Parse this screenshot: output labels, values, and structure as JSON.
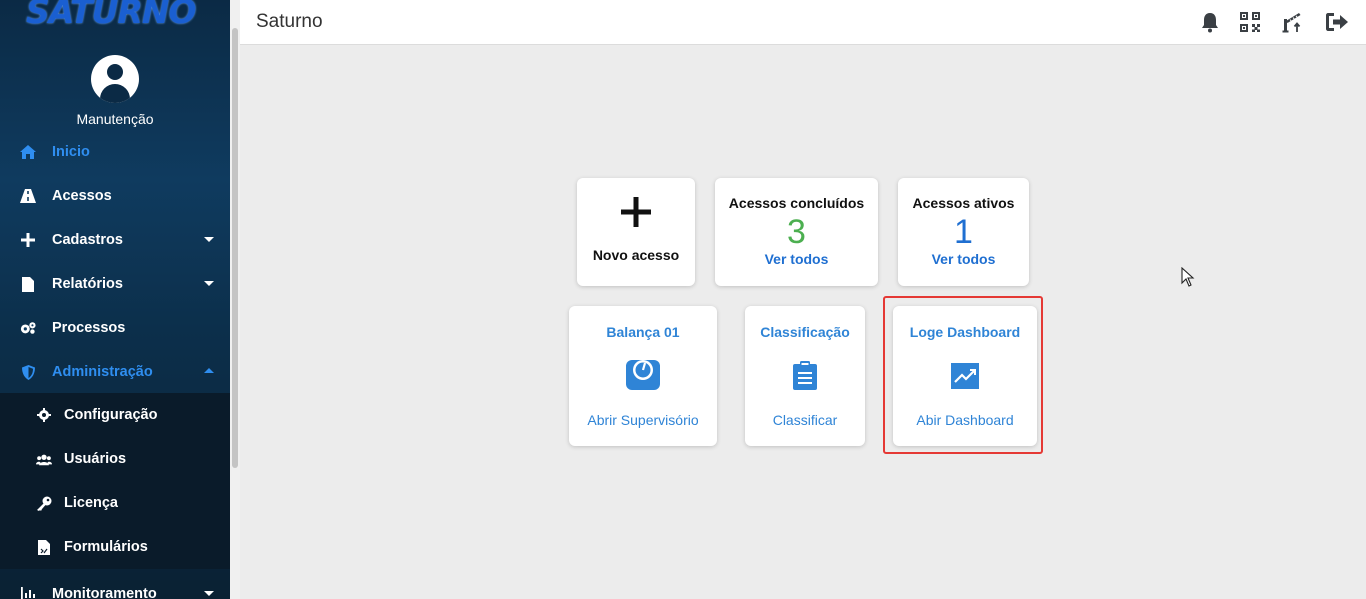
{
  "app": {
    "logo": "SATURNO",
    "title": "Saturno"
  },
  "user": {
    "name": "Manutenção"
  },
  "sidebar": {
    "items": [
      {
        "label": "Inicio",
        "icon": "home-icon",
        "active": true
      },
      {
        "label": "Acessos",
        "icon": "road-icon"
      },
      {
        "label": "Cadastros",
        "icon": "plus-icon",
        "expandable": true
      },
      {
        "label": "Relatórios",
        "icon": "file-icon",
        "expandable": true
      },
      {
        "label": "Processos",
        "icon": "gears-icon"
      },
      {
        "label": "Administração",
        "icon": "shield-icon",
        "expandable": true,
        "expanded": true
      },
      {
        "label": "Monitoramento",
        "icon": "chart-bar-icon",
        "expandable": true
      }
    ],
    "admin_subitems": [
      {
        "label": "Configuração",
        "icon": "cog-icon"
      },
      {
        "label": "Usuários",
        "icon": "users-icon"
      },
      {
        "label": "Licença",
        "icon": "key-icon"
      },
      {
        "label": "Formulários",
        "icon": "form-file-icon"
      }
    ]
  },
  "header_icons": [
    "bell-icon",
    "qr-code-icon",
    "barrier-icon",
    "logout-icon"
  ],
  "cards": {
    "novo": {
      "label": "Novo acesso"
    },
    "concluidos": {
      "title": "Acessos concluídos",
      "value": "3",
      "link": "Ver todos",
      "value_color": "#4caf50"
    },
    "ativos": {
      "title": "Acessos ativos",
      "value": "1",
      "link": "Ver todos",
      "value_color": "#1f6fd1"
    },
    "balanca": {
      "title": "Balança 01",
      "link": "Abrir Supervisório"
    },
    "classificacao": {
      "title": "Classificação",
      "link": "Classificar"
    },
    "dashboard": {
      "title": "Loge Dashboard",
      "link": "Abir Dashboard"
    }
  },
  "colors": {
    "accent": "#2f84d6",
    "sidebar_bg": "#0b2a45",
    "highlight": "#e53935"
  }
}
